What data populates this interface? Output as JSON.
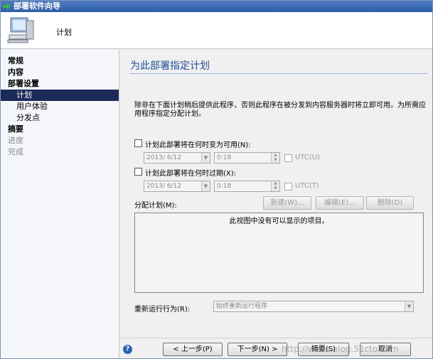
{
  "window": {
    "title": "部署软件向导"
  },
  "header": {
    "title": "计划"
  },
  "sidebar": {
    "items": [
      {
        "label": "常规"
      },
      {
        "label": "内容"
      },
      {
        "label": "部署设置"
      },
      {
        "label": "计划"
      },
      {
        "label": "用户体验"
      },
      {
        "label": "分发点"
      },
      {
        "label": "摘要"
      },
      {
        "label": "进度"
      },
      {
        "label": "完成"
      }
    ]
  },
  "main": {
    "title": "为此部署指定计划",
    "description": "除非在下面计划稍后提供此程序，否则此程序在被分发到内容服务器时将立即可用。为所需应用程序指定分配计划。",
    "available": {
      "label": "计划此部署将在何时变为可用(N):",
      "date": "2013/ 6/12",
      "time": "0:18",
      "utc_label": "UTC(U)"
    },
    "expire": {
      "label": "计划此部署将在何时过期(X):",
      "date": "2013/ 6/12",
      "time": "0:18",
      "utc_label": "UTC(T)"
    },
    "schedule": {
      "label": "分配计划(M):",
      "new_label": "新建(W)...",
      "edit_label": "编辑(E)...",
      "delete_label": "删除(D)",
      "empty_text": "此视图中没有可以显示的项目。"
    },
    "rerun": {
      "label": "重新运行行为(R):",
      "value": "始终重新运行程序"
    }
  },
  "footer": {
    "help_glyph": "?",
    "prev_label": "< 上一步(P)",
    "next_label": "下一步(N) >",
    "summary_label": "摘要(S)",
    "cancel_label": "取消"
  },
  "watermark": "http://wnos.blog.51cto.com",
  "colors": {
    "selected_bg": "#1c2a5a",
    "title_blue": "#1f4e9b",
    "titlebar": "#2f5da6"
  }
}
